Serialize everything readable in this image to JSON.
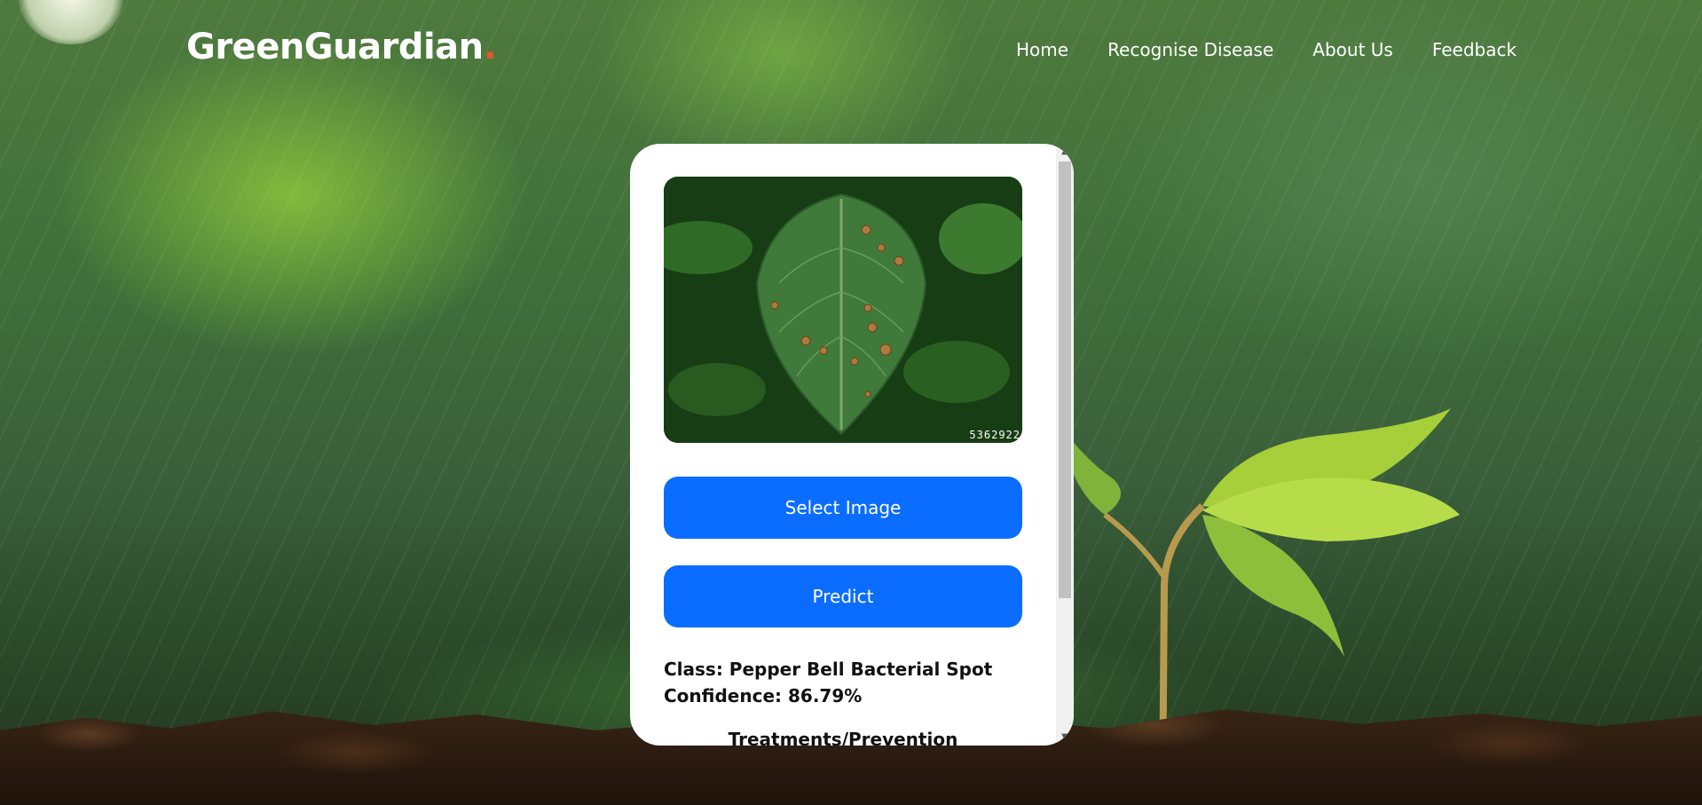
{
  "header": {
    "logo_text": "GreenGuardian",
    "logo_dot": ".",
    "nav": [
      {
        "label": "Home"
      },
      {
        "label": "Recognise Disease"
      },
      {
        "label": "About Us"
      },
      {
        "label": "Feedback"
      }
    ]
  },
  "card": {
    "preview_image_id": "5362922",
    "select_button": "Select Image",
    "predict_button": "Predict",
    "result_class": "Class: Pepper Bell Bacterial Spot",
    "result_confidence": "Confidence: 86.79%",
    "treatments_title": "Treatments/Prevention"
  },
  "colors": {
    "primary_button": "#0b6dff",
    "logo_dot": "#e0582c",
    "card_background": "#ffffff"
  }
}
